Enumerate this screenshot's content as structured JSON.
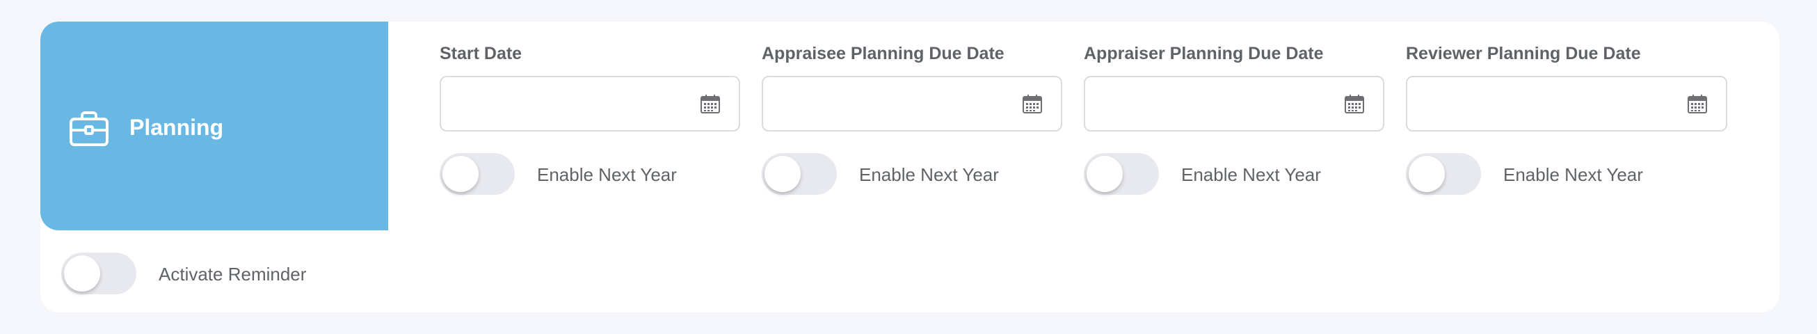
{
  "section": {
    "title": "Planning",
    "icon": "briefcase-icon",
    "tile_color": "#69b8e4"
  },
  "fields": [
    {
      "label": "Start Date",
      "value": "",
      "toggle_label": "Enable Next Year",
      "toggle_on": false
    },
    {
      "label": "Appraisee Planning Due Date",
      "value": "",
      "toggle_label": "Enable Next Year",
      "toggle_on": false
    },
    {
      "label": "Appraiser Planning Due Date",
      "value": "",
      "toggle_label": "Enable Next Year",
      "toggle_on": false
    },
    {
      "label": "Reviewer Planning Due Date",
      "value": "",
      "toggle_label": "Enable Next Year",
      "toggle_on": false
    }
  ],
  "reminder": {
    "label": "Activate Reminder",
    "on": false
  }
}
